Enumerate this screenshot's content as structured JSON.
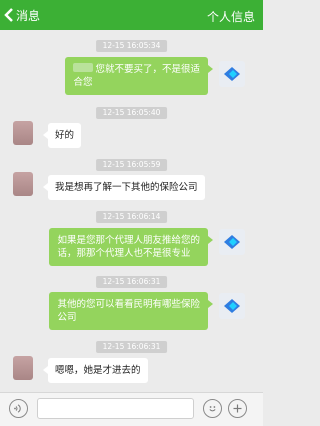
{
  "header": {
    "back_label": "消息",
    "title": "个人信息"
  },
  "messages": [
    {
      "kind": "time",
      "text": "12-15 16:05:34"
    },
    {
      "kind": "sent",
      "text_line1": "您就不要买了，不是很适",
      "text_line2": "合您"
    },
    {
      "kind": "time",
      "text": "12-15 16:05:40"
    },
    {
      "kind": "received",
      "text": "好的"
    },
    {
      "kind": "time",
      "text": "12-15 16:05:59"
    },
    {
      "kind": "received",
      "text": "我是想再了解一下其他的保险公司"
    },
    {
      "kind": "time",
      "text": "12-15 16:06:14"
    },
    {
      "kind": "sent",
      "text_line1": "如果是您那个代理人朋友推给您的",
      "text_line2": "话，那那个代理人也不是很专业"
    },
    {
      "kind": "time",
      "text": "12-15 16:06:31"
    },
    {
      "kind": "sent",
      "text_line1": "其他的您可以看看民明有哪些保险",
      "text_line2": "公司"
    },
    {
      "kind": "time",
      "text": "12-15 16:06:31"
    },
    {
      "kind": "received",
      "text": "嗯嗯，她是才进去的"
    }
  ],
  "colors": {
    "header": "#3cb035",
    "sent_bubble": "#94d45d",
    "background": "#ebebeb"
  },
  "icons": {
    "back": "chevron-left-icon",
    "logo": "diamond-logo-icon",
    "voice": "voice-icon",
    "emoji": "emoji-icon",
    "plus": "plus-icon"
  }
}
